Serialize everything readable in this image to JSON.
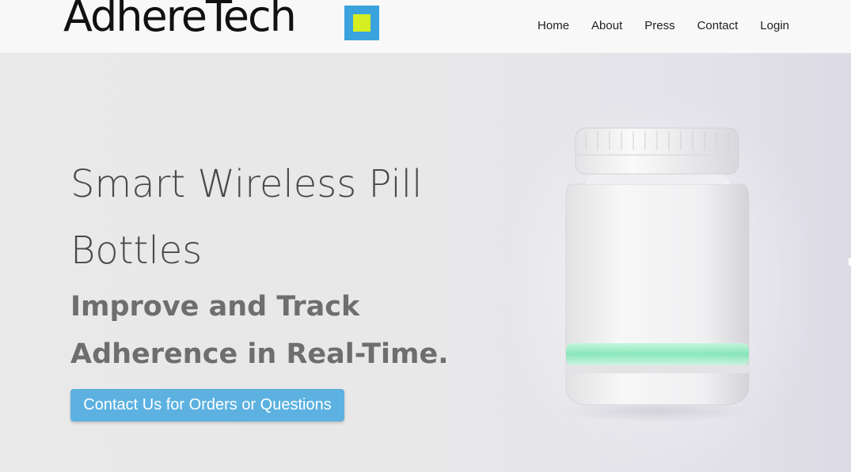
{
  "header": {
    "logo_text": "AdhereTech",
    "nav": [
      {
        "label": "Home"
      },
      {
        "label": "About"
      },
      {
        "label": "Press"
      },
      {
        "label": "Contact"
      },
      {
        "label": "Login"
      }
    ]
  },
  "hero": {
    "title": "Smart Wireless Pill Bottles",
    "subtitle": "Improve and Track Adherence in Real-Time.",
    "cta_label": "Contact Us for Orders or Questions"
  },
  "colors": {
    "brand_blue": "#3aa3de",
    "brand_lime": "#d4ee22",
    "button_blue": "#5cb1e0",
    "led_green": "#8ff0c4"
  },
  "icons": {
    "logo_mark": "square-logo-icon",
    "product": "pill-bottle-image"
  }
}
